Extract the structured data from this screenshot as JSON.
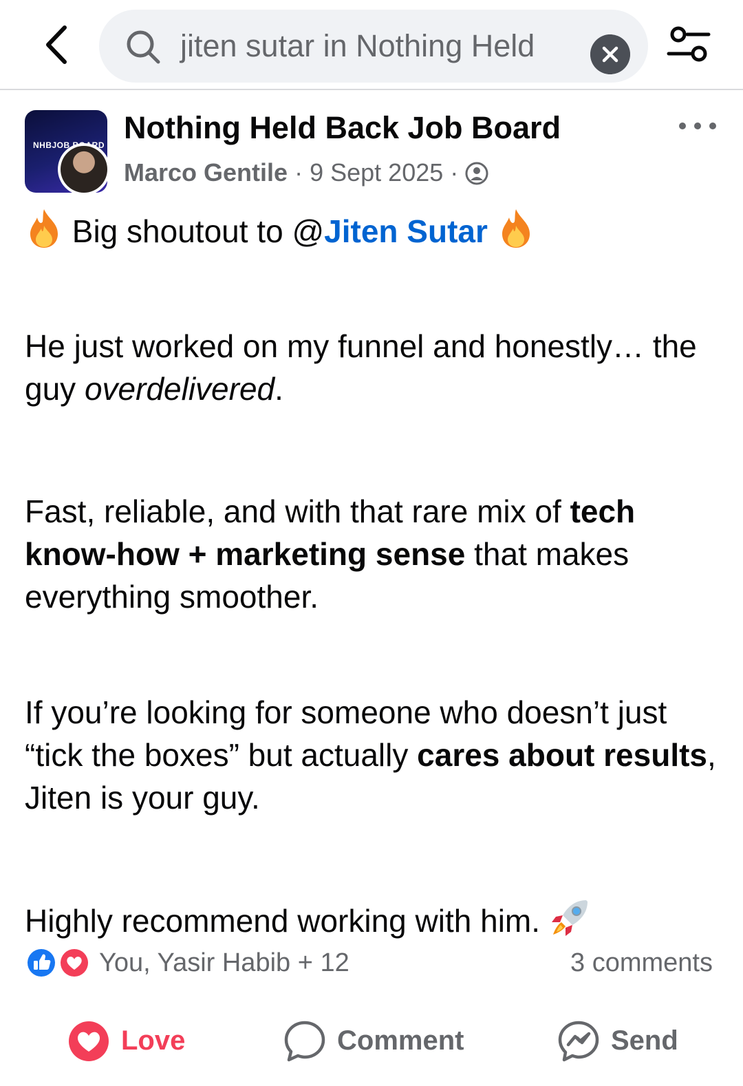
{
  "search": {
    "query": "jiten sutar in Nothing Held"
  },
  "post": {
    "group_name": "Nothing Held Back Job Board",
    "group_thumb_text": "NHBJOB BOARD",
    "author": "Marco Gentile",
    "separator": "·",
    "date": "9 Sept 2025",
    "paragraph1": {
      "prefix": "Big shoutout to @",
      "mention": "Jiten Sutar"
    },
    "paragraph2": {
      "text1": "He just worked on my funnel and honestly… the guy ",
      "italic": "overdelivered",
      "text2": "."
    },
    "paragraph3": {
      "text1": "Fast, reliable, and with that rare mix of ",
      "bold": "tech know-how + marketing sense",
      "text2": " that makes everything smoother."
    },
    "paragraph4": {
      "text1": "If you’re looking for someone who doesn’t just “tick the boxes” but actually ",
      "bold": "cares about results",
      "text2": ", Jiten is your guy."
    },
    "paragraph5": {
      "text": "Highly recommend working with him. "
    }
  },
  "reactions": {
    "names": "You, Yasir Habib + 12",
    "comments": "3 comments"
  },
  "actions": {
    "love": "Love",
    "comment": "Comment",
    "send": "Send"
  },
  "colors": {
    "mention": "#0064d1",
    "love": "#f33e58",
    "like": "#1877f2",
    "muted": "#65676b"
  }
}
